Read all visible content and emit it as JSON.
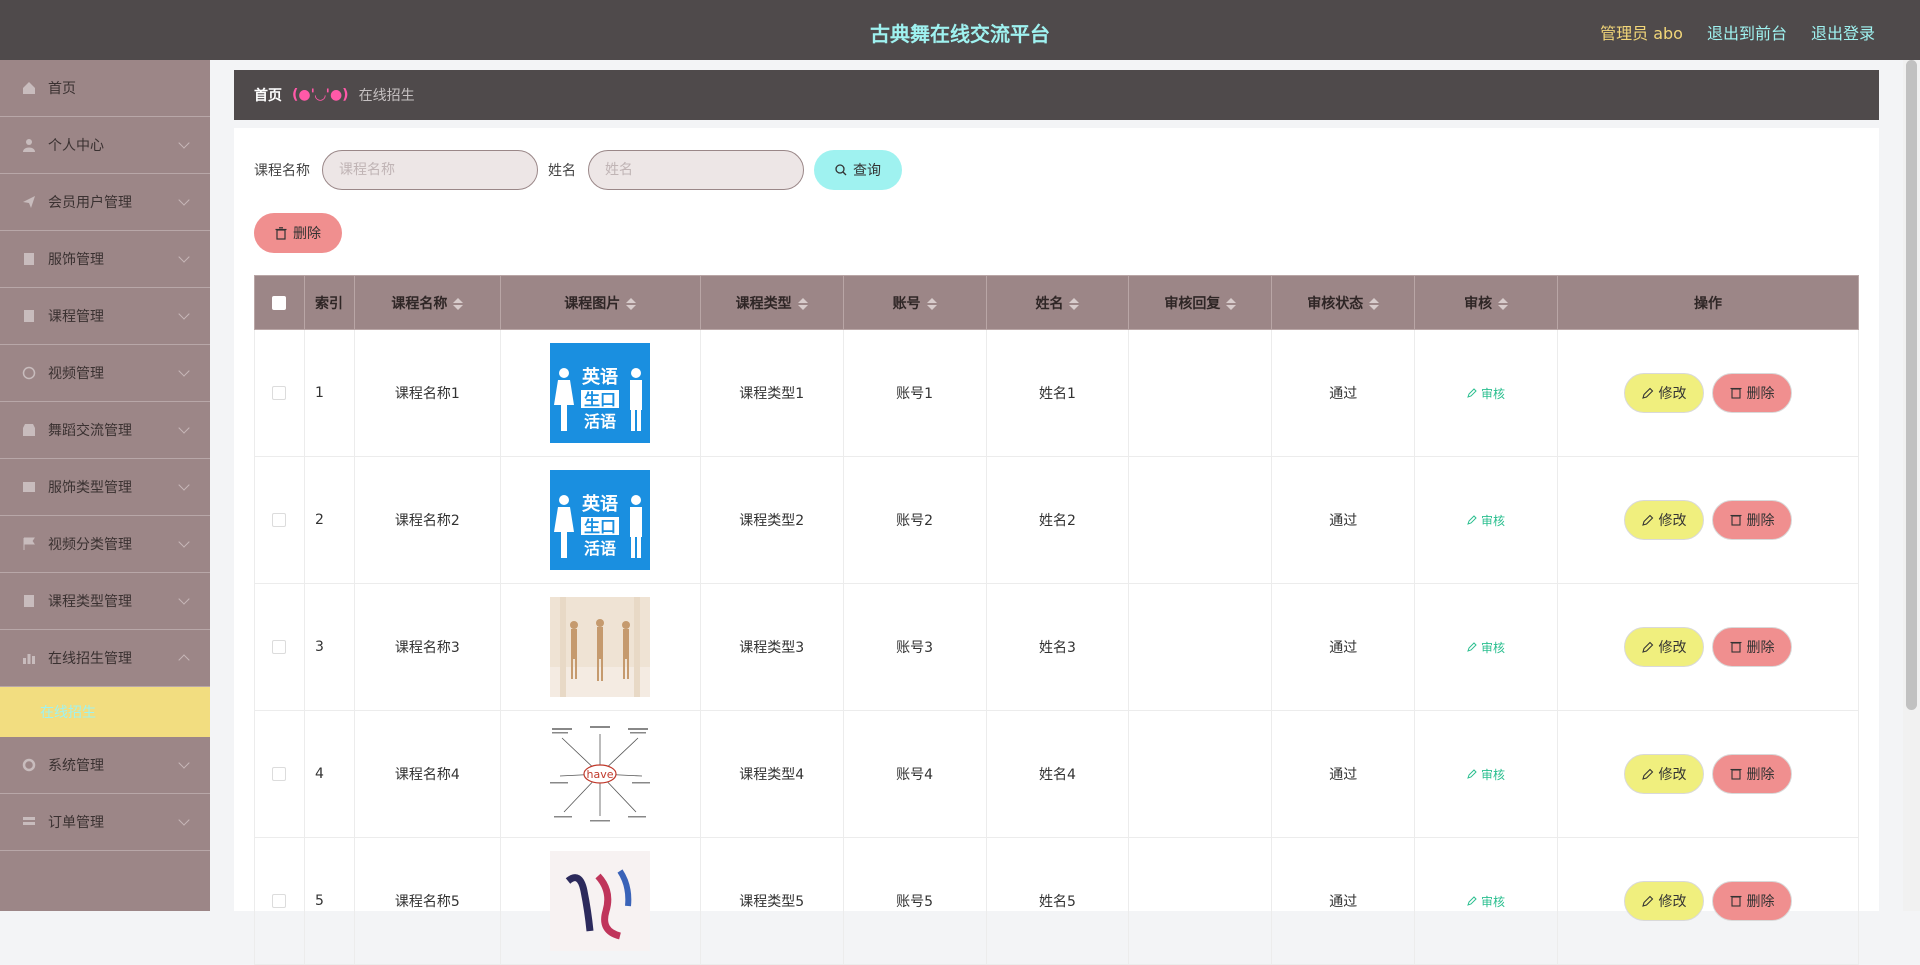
{
  "header": {
    "title": "古典舞在线交流平台",
    "user": "管理员 abo",
    "to_front": "退出到前台",
    "logout": "退出登录"
  },
  "sidebar": {
    "items": [
      {
        "label": "首页",
        "icon": "home-icon"
      },
      {
        "label": "个人中心",
        "icon": "person-icon"
      },
      {
        "label": "会员用户管理",
        "icon": "send-icon"
      },
      {
        "label": "服饰管理",
        "icon": "doc-icon"
      },
      {
        "label": "课程管理",
        "icon": "doc-icon"
      },
      {
        "label": "视频管理",
        "icon": "clock-icon"
      },
      {
        "label": "舞蹈交流管理",
        "icon": "shop-icon"
      },
      {
        "label": "服饰类型管理",
        "icon": "doc-icon"
      },
      {
        "label": "视频分类管理",
        "icon": "flag-icon"
      },
      {
        "label": "课程类型管理",
        "icon": "doc-icon"
      },
      {
        "label": "在线招生管理",
        "icon": "chart-icon"
      },
      {
        "label": "系统管理",
        "icon": "gear-icon"
      },
      {
        "label": "订单管理",
        "icon": "list-icon"
      }
    ],
    "active_sub": "在线招生"
  },
  "breadcrumb": {
    "home": "首页",
    "face": "(●'◡'●)",
    "current": "在线招生"
  },
  "search": {
    "course_label": "课程名称",
    "course_placeholder": "课程名称",
    "name_label": "姓名",
    "name_placeholder": "姓名",
    "query_button": "查询"
  },
  "toolbar": {
    "delete_button": "删除"
  },
  "table": {
    "headers": [
      "索引",
      "课程名称",
      "课程图片",
      "课程类型",
      "账号",
      "姓名",
      "审核回复",
      "审核状态",
      "审核",
      "操作"
    ],
    "rows": [
      {
        "idx": "1",
        "course": "课程名称1",
        "type": "课程类型1",
        "account": "账号1",
        "name": "姓名1",
        "reply": "",
        "status": "通过",
        "image": "english-poster"
      },
      {
        "idx": "2",
        "course": "课程名称2",
        "type": "课程类型2",
        "account": "账号2",
        "name": "姓名2",
        "reply": "",
        "status": "通过",
        "image": "english-poster"
      },
      {
        "idx": "3",
        "course": "课程名称3",
        "type": "课程类型3",
        "account": "账号3",
        "name": "姓名3",
        "reply": "",
        "status": "通过",
        "image": "dancers-photo"
      },
      {
        "idx": "4",
        "course": "课程名称4",
        "type": "课程类型4",
        "account": "账号4",
        "name": "姓名4",
        "reply": "",
        "status": "通过",
        "image": "have-mindmap"
      },
      {
        "idx": "5",
        "course": "课程名称5",
        "type": "课程类型5",
        "account": "账号5",
        "name": "姓名5",
        "reply": "",
        "status": "通过",
        "image": "calligraphy"
      }
    ],
    "audit_link": "审核",
    "edit_button": "修改",
    "delete_button": "删除",
    "poster_text": [
      "英语",
      "生口",
      "活语"
    ],
    "mindmap_word": "have"
  }
}
